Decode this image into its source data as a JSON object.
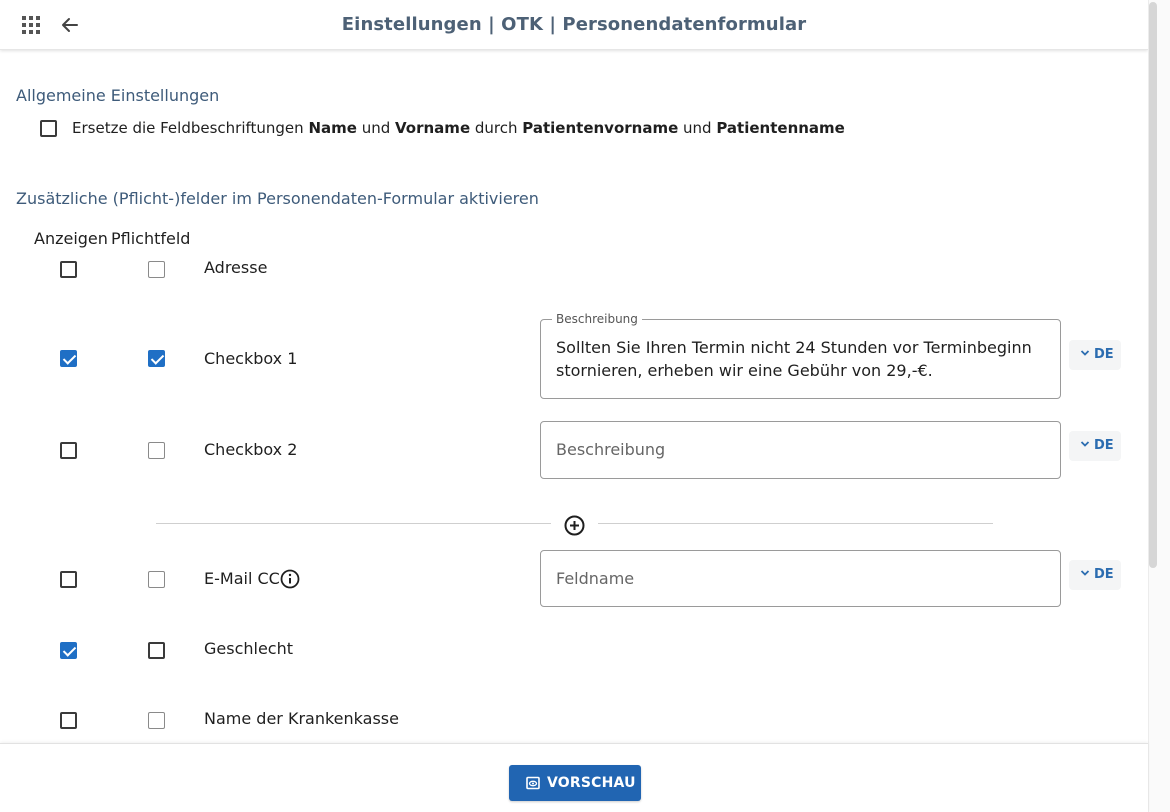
{
  "header": {
    "title": "Einstellungen | OTK | Personendatenformular",
    "apps_icon": "apps-grid-icon",
    "back_icon": "arrow-left-icon"
  },
  "general": {
    "title": "Allgemeine Einstellungen",
    "option": {
      "checked": false,
      "text_1": "Ersetze die Feldbeschriftungen ",
      "bold_1": "Name",
      "text_2": " und ",
      "bold_2": "Vorname",
      "text_3": " durch ",
      "bold_3": "Patientenvorname",
      "text_4": " und ",
      "bold_4": "Patientenname"
    }
  },
  "fields_section": {
    "title": "Zusätzliche (Pflicht-)felder im Personendaten-Formular aktivieren",
    "col_show": "Anzeigen",
    "col_required": "Pflichtfeld",
    "rows": [
      {
        "label": "Adresse",
        "show": false,
        "required": false
      },
      {
        "label": "Checkbox 1",
        "show": true,
        "required": true,
        "description_legend": "Beschreibung",
        "description_value": "Sollten Sie Ihren Termin nicht 24 Stunden vor Terminbeginn stornieren, erheben wir eine Gebühr von 29,-€.",
        "lang": "DE"
      },
      {
        "label": "Checkbox 2",
        "show": false,
        "required": false,
        "description_placeholder": "Beschreibung",
        "lang": "DE"
      },
      {
        "label": "E-Mail CC",
        "show": false,
        "required": false,
        "fieldname_placeholder": "Feldname",
        "lang": "DE",
        "info_icon": "info-circle-icon"
      },
      {
        "label": "Geschlecht",
        "show": true,
        "required": false
      },
      {
        "label": "Name der Krankenkasse",
        "show": false,
        "required": false
      }
    ],
    "add_icon": "plus-circle-icon"
  },
  "footer": {
    "preview_label": "VORSCHAU",
    "preview_icon": "eye-preview-icon"
  },
  "colors": {
    "accent": "#1f6fc5",
    "title": "#4d6176",
    "button": "#2165b2"
  }
}
